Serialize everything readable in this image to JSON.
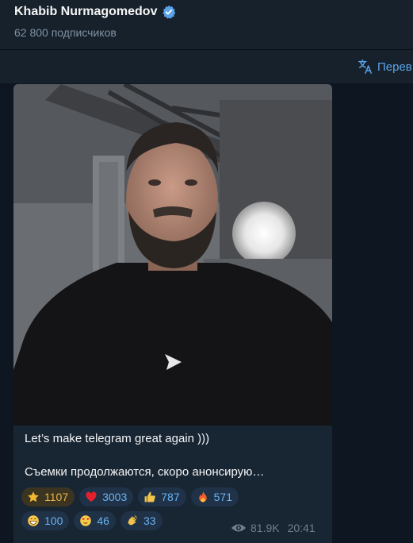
{
  "header": {
    "title": "Khabib Nurmagomedov",
    "subtitle": "62 800 подписчиков"
  },
  "toolbar": {
    "translate_label": "Перев"
  },
  "post": {
    "caption_line1": "Let’s make telegram great again )))",
    "caption_line2": "Съемки продолжаются, скоро анонсирую…",
    "views": "81.9K",
    "time": "20:41"
  },
  "reactions": [
    {
      "icon": "star-icon",
      "count": "1107"
    },
    {
      "icon": "heart-icon",
      "count": "3003"
    },
    {
      "icon": "thumbs-up-icon",
      "count": "787"
    },
    {
      "icon": "fire-icon",
      "count": "571"
    },
    {
      "icon": "grin-icon",
      "count": "100"
    },
    {
      "icon": "in-love-face-icon",
      "count": "46"
    },
    {
      "icon": "clap-icon",
      "count": "33"
    }
  ],
  "colors": {
    "background": "#0e1621",
    "panel": "#17212b",
    "bubble": "#182533",
    "accent": "#5aa3e8",
    "star": "#e8b34a"
  }
}
